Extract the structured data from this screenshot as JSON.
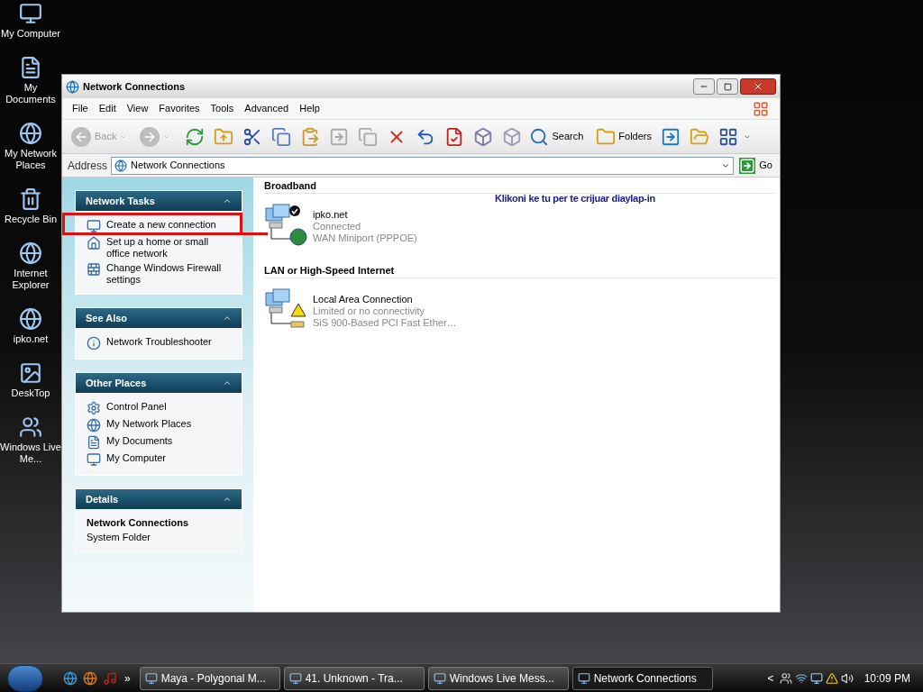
{
  "desktop_icons": [
    {
      "label": "My Computer"
    },
    {
      "label": "My Documents"
    },
    {
      "label": "My Network Places"
    },
    {
      "label": "Recycle Bin"
    },
    {
      "label": "Internet Explorer"
    },
    {
      "label": "ipko.net"
    },
    {
      "label": "DeskTop"
    },
    {
      "label": "Windows Live Me..."
    }
  ],
  "window": {
    "title": "Network Connections"
  },
  "menu": [
    "File",
    "Edit",
    "View",
    "Favorites",
    "Tools",
    "Advanced",
    "Help"
  ],
  "toolbar": {
    "back": {
      "label": "Back",
      "disabled": true
    },
    "forward": {
      "disabled": true
    },
    "search": {
      "label": "Search"
    },
    "folders": {
      "label": "Folders"
    }
  },
  "address": {
    "label": "Address",
    "value": "Network Connections",
    "go": "Go"
  },
  "task_panels": [
    {
      "title": "Network Tasks",
      "expanded": true,
      "kind": "links",
      "items": [
        "Create a new connection",
        "Set up a home or small office network",
        "Change Windows Firewall settings"
      ]
    },
    {
      "title": "See Also",
      "expanded": true,
      "kind": "links",
      "items": [
        "Network Troubleshooter"
      ]
    },
    {
      "title": "Other Places",
      "expanded": true,
      "kind": "links",
      "items": [
        "Control Panel",
        "My Network Places",
        "My Documents",
        "My Computer"
      ]
    },
    {
      "title": "Details",
      "expanded": true,
      "kind": "details",
      "items": [
        "Network Connections",
        "System Folder"
      ]
    }
  ],
  "annotation": {
    "text": "Klikoni ke tu per te crijuar diaylap-in"
  },
  "groups": [
    {
      "title": "Broadband",
      "connections": [
        {
          "kind": "broadband",
          "name": "ipko.net",
          "status": "Connected",
          "device": "WAN Miniport (PPPOE)"
        }
      ]
    },
    {
      "title": "LAN or High-Speed Internet",
      "connections": [
        {
          "kind": "lan",
          "name": "Local Area Connection",
          "status": "Limited or no connectivity",
          "device": "SiS 900-Based PCI Fast Ether…"
        }
      ]
    }
  ],
  "taskbar": {
    "more": "»",
    "tasks": [
      {
        "label": "Maya - Polygonal M...",
        "selected": false
      },
      {
        "label": "41. Unknown - Tra...",
        "selected": false
      },
      {
        "label": "Windows Live Mess...",
        "selected": false
      },
      {
        "label": "Network Connections",
        "selected": true
      }
    ],
    "tray_arrow": "<",
    "clock": "10:09 PM"
  }
}
